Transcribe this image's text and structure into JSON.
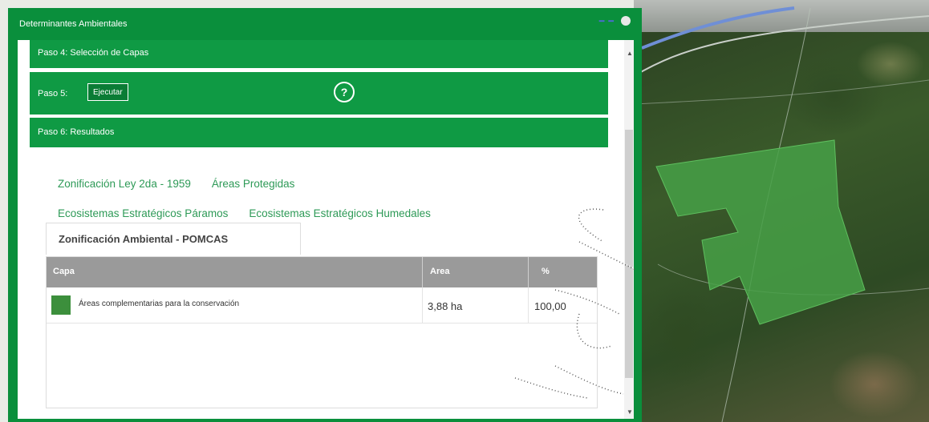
{
  "panel": {
    "title": "Determinantes Ambientales",
    "steps": {
      "step4_label": "Paso 4: Selección de Capas",
      "step5_label": "Paso 5:",
      "execute_label": "Ejecutar",
      "help_glyph": "?",
      "step6_label": "Paso 6: Resultados"
    },
    "result_tabs": [
      "Zonificación Ley 2da - 1959",
      "Áreas Protegidas",
      "Ecosistemas Estratégicos Páramos",
      "Ecosistemas Estratégicos Humedales"
    ],
    "active_tab": "Zonificación Ambiental - POMCAS",
    "table": {
      "headers": {
        "capa": "Capa",
        "area": "Area",
        "pct": "%"
      },
      "rows": [
        {
          "capa": "Áreas complementarias para la conservación",
          "area": "3,88 ha",
          "pct": "100,00",
          "color": "#3c8f3c"
        }
      ]
    }
  },
  "colors": {
    "accent": "#0a8f3c",
    "header_bar": "#0f9a44",
    "tab_text": "#2e9a57",
    "table_header": "#9a9a9a"
  },
  "icons": [
    "help-icon",
    "close-icon",
    "scroll-up-icon",
    "scroll-down-icon"
  ]
}
